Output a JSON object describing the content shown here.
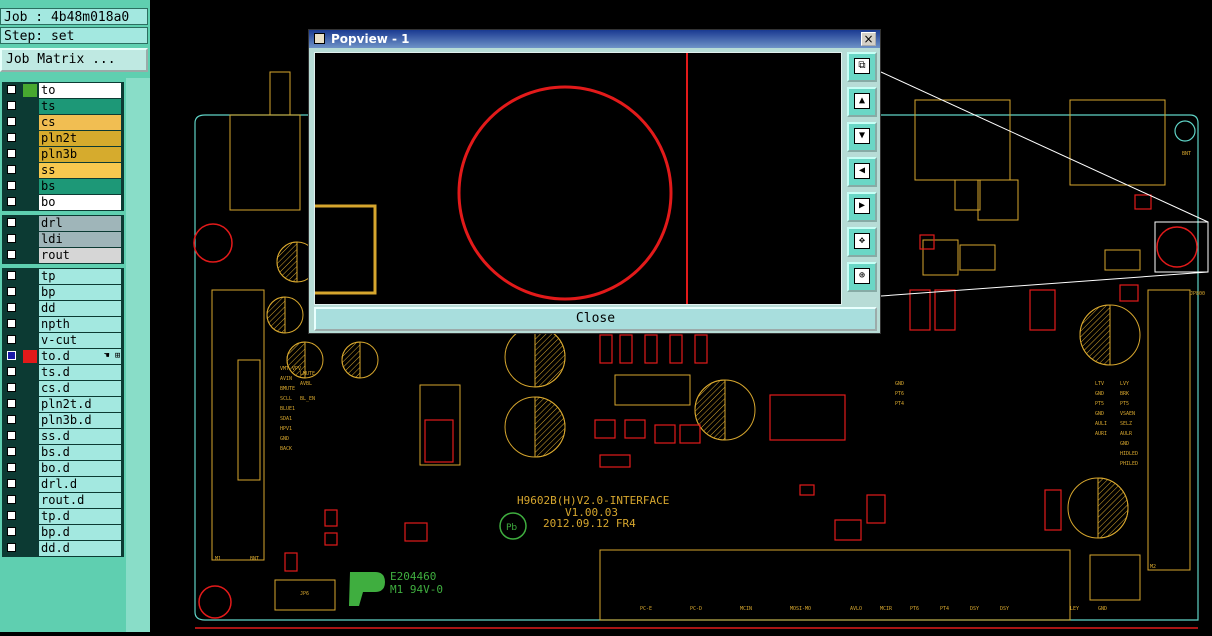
{
  "job": {
    "label": "Job : 4b48m018a0"
  },
  "step": {
    "label": "Step: set"
  },
  "job_matrix_button": "Job Matrix ...",
  "layer_groups": [
    [
      {
        "name": "to",
        "color": "#ffffff",
        "swatch": "#48a830"
      },
      {
        "name": "ts",
        "color": "#1d9877",
        "swatch": ""
      },
      {
        "name": "cs",
        "color": "#f1be52",
        "swatch": ""
      },
      {
        "name": "pln2t",
        "color": "#d6ab2d",
        "swatch": ""
      },
      {
        "name": "pln3b",
        "color": "#d6ab2d",
        "swatch": ""
      },
      {
        "name": "ss",
        "color": "#f7c84f",
        "swatch": ""
      },
      {
        "name": "bs",
        "color": "#1d9877",
        "swatch": ""
      },
      {
        "name": "bo",
        "color": "#ffffff",
        "swatch": ""
      }
    ],
    [
      {
        "name": "drl",
        "color": "#9fb5b9",
        "swatch": ""
      },
      {
        "name": "ldi",
        "color": "#9fb5b9",
        "swatch": ""
      },
      {
        "name": "rout",
        "color": "#d6d6d6",
        "swatch": ""
      }
    ],
    [
      {
        "name": "tp",
        "color": "#a3e8e0",
        "swatch": ""
      },
      {
        "name": "bp",
        "color": "#a3e8e0",
        "swatch": ""
      },
      {
        "name": "dd",
        "color": "#a3e8e0",
        "swatch": ""
      },
      {
        "name": "npth",
        "color": "#a3e8e0",
        "swatch": ""
      },
      {
        "name": "v-cut",
        "color": "#a3e8e0",
        "swatch": ""
      },
      {
        "name": "to.d",
        "color": "#a3e8e0",
        "swatch": "#e21a1a",
        "selected": true
      },
      {
        "name": "ts.d",
        "color": "#a3e8e0",
        "swatch": ""
      },
      {
        "name": "cs.d",
        "color": "#a3e8e0",
        "swatch": ""
      },
      {
        "name": "pln2t.d",
        "color": "#a3e8e0",
        "swatch": ""
      },
      {
        "name": "pln3b.d",
        "color": "#a3e8e0",
        "swatch": ""
      },
      {
        "name": "ss.d",
        "color": "#a3e8e0",
        "swatch": ""
      },
      {
        "name": "bs.d",
        "color": "#a3e8e0",
        "swatch": ""
      },
      {
        "name": "bo.d",
        "color": "#a3e8e0",
        "swatch": ""
      },
      {
        "name": "drl.d",
        "color": "#a3e8e0",
        "swatch": ""
      },
      {
        "name": "rout.d",
        "color": "#a3e8e0",
        "swatch": ""
      },
      {
        "name": "tp.d",
        "color": "#a3e8e0",
        "swatch": ""
      },
      {
        "name": "bp.d",
        "color": "#a3e8e0",
        "swatch": ""
      },
      {
        "name": "dd.d",
        "color": "#a3e8e0",
        "swatch": ""
      }
    ]
  ],
  "popup": {
    "title": "Popview - 1",
    "close_button": "Close",
    "title_close_glyph": "×",
    "tools": [
      "copy-view",
      "zoom-in-view",
      "zoom-out-view",
      "pan-left-view",
      "pan-right-view",
      "fit-view",
      "center-view"
    ]
  },
  "board_text": {
    "interface_line1": "H9602B(H)V2.0-INTERFACE",
    "interface_line2": "V1.00.03",
    "interface_line3": "2012.09.12 FR4",
    "cert_number": "E204460",
    "cert_rating": "M1 94V-0",
    "pb_mark": "Pb"
  },
  "colors": {
    "panel_bg": "#5fcfb0",
    "board_outline": "#5fd3c6",
    "silk": "#d6a62e",
    "pad_red": "#e21a1a",
    "green_mark": "#3fae3f"
  }
}
